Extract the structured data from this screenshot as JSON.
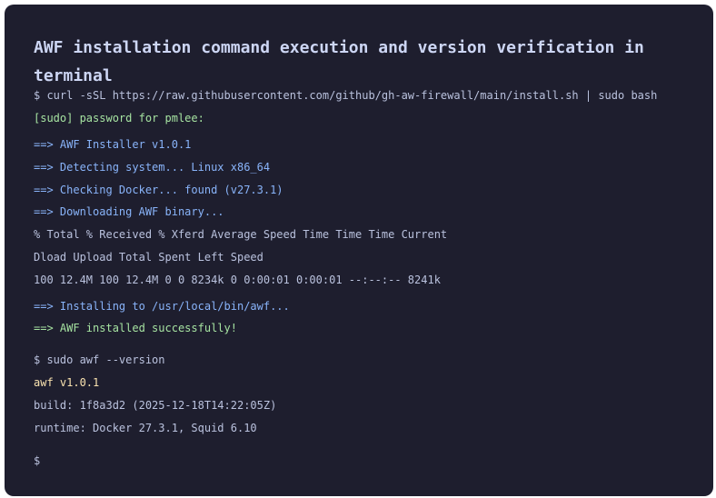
{
  "title": "AWF installation command execution and version verification in terminal",
  "lines": {
    "cmd_install": "$ curl -sSL https://raw.githubusercontent.com/github/gh-aw-firewall/main/install.sh | sudo bash",
    "sudo_prompt": "[sudo] password for pmlee:",
    "installer": "==> AWF Installer v1.0.1",
    "detect": "==> Detecting system... Linux x86_64",
    "docker": "==> Checking Docker... found (v27.3.1)",
    "download": "==> Downloading AWF binary...",
    "curl_header1": "% Total % Received % Xferd Average Speed Time Time Time Current",
    "curl_header2": "Dload Upload Total Spent Left Speed",
    "curl_progress": "100 12.4M 100 12.4M 0 0 8234k 0 0:00:01 0:00:01 --:--:-- 8241k",
    "installing": "==> Installing to /usr/local/bin/awf...",
    "installed": "==> AWF installed successfully!",
    "cmd_version": "$ sudo awf --version",
    "version": "awf v1.0.1",
    "build": "build: 1f8a3d2 (2025-12-18T14:22:05Z)",
    "runtime": "runtime: Docker 27.3.1, Squid 6.10",
    "final_prompt": "$"
  },
  "colors": {
    "background": "#1e1e2e",
    "text": "#bac2de",
    "info": "#89b4fa",
    "success": "#a6e3a1",
    "highlight": "#f9e2af"
  }
}
